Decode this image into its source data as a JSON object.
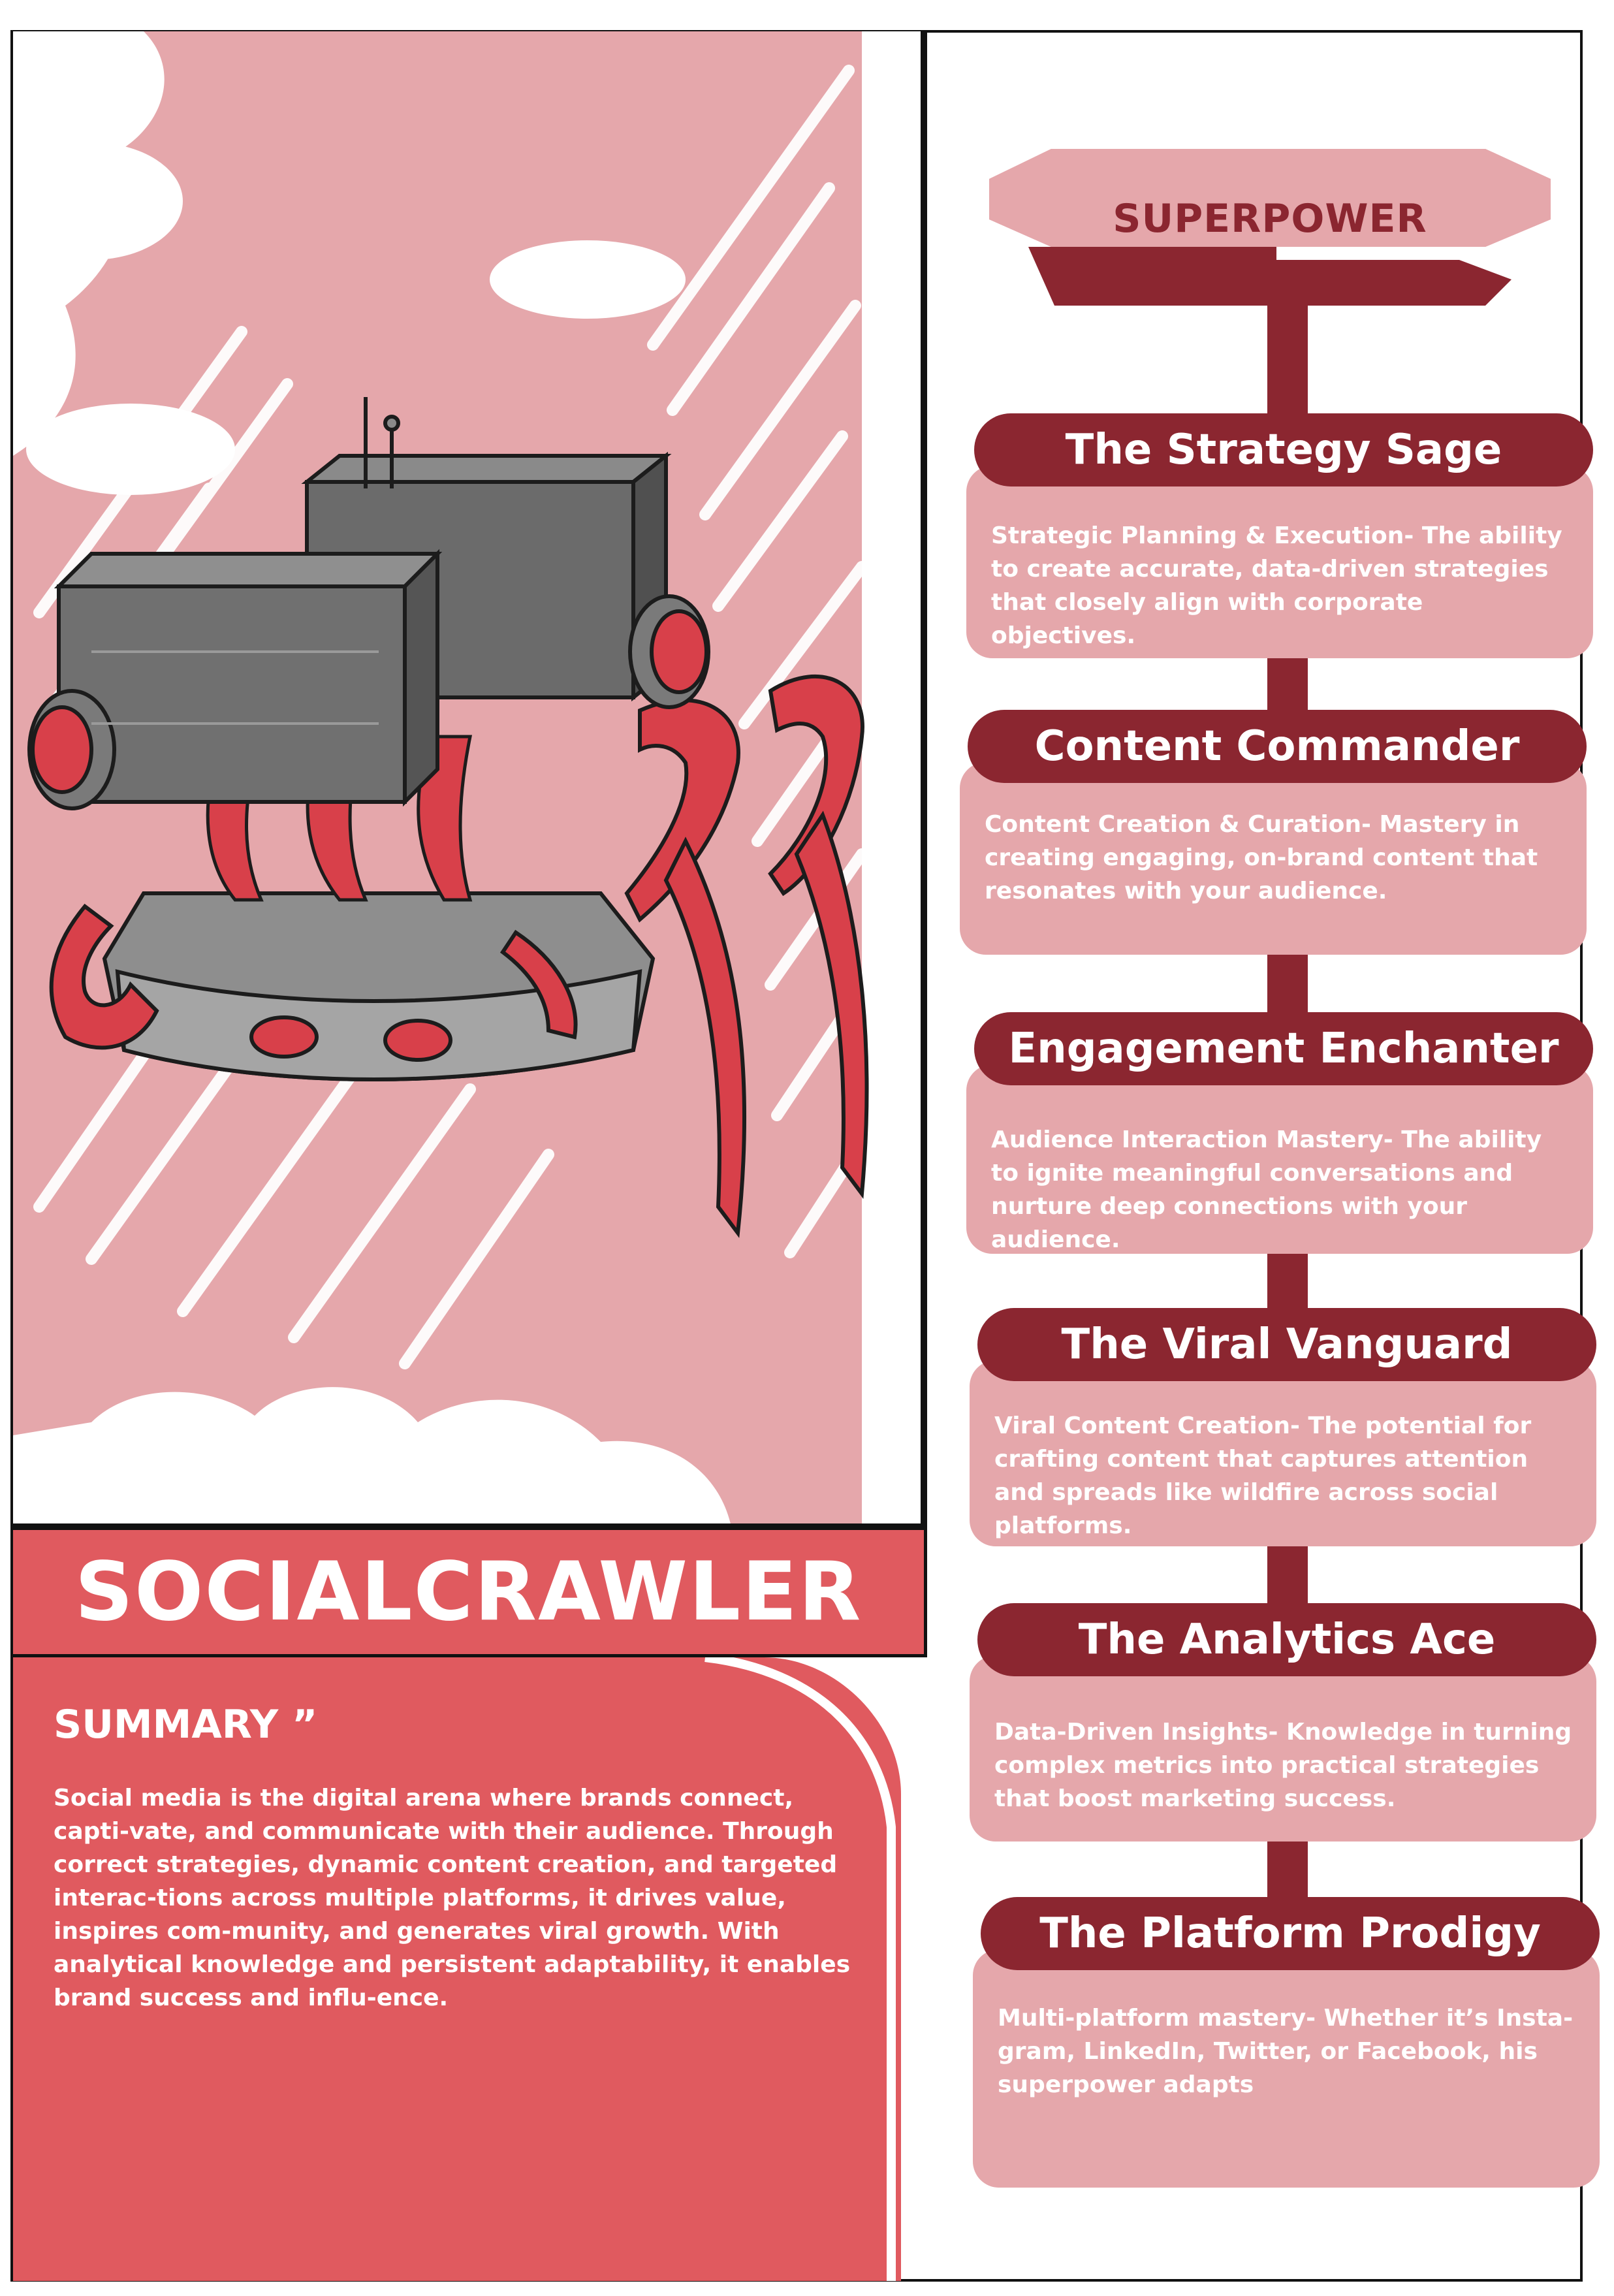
{
  "character": {
    "name": "SOCIALCRAWLER"
  },
  "summary": {
    "title": "SUMMARY ”",
    "text": "Social media is the digital arena where brands connect, capti-vate, and communicate with their audience. Through correct strategies, dynamic content creation, and targeted interac-tions across multiple platforms, it drives value, inspires com-munity, and generates viral growth. With analytical knowledge and persistent adaptability, it enables brand success and influ-ence."
  },
  "superpower": {
    "label": "SUPERPOWER",
    "cards": [
      {
        "title": "The Strategy Sage",
        "text": "Strategic Planning & Execution- The ability to create accurate, data-driven strategies that closely align with corporate objectives."
      },
      {
        "title": "Content Commander",
        "text": "Content Creation & Curation- Mastery in creating engaging, on-brand content that resonates with your audience."
      },
      {
        "title": "Engagement Enchanter",
        "text": "Audience Interaction Mastery- The ability to ignite meaningful conversations and nurture deep connections with your audience."
      },
      {
        "title": "The Viral Vanguard",
        "text": "Viral Content Creation- The potential for crafting content that captures attention and spreads like wildfire across social platforms."
      },
      {
        "title": "The Analytics Ace",
        "text": "Data-Driven Insights- Knowledge in turning complex metrics into practical strategies that boost marketing success."
      },
      {
        "title": "The Platform Prodigy",
        "text": "Multi-platform mastery- Whether it’s Insta-gram, LinkedIn, Twitter, or Facebook, his superpower adapts"
      }
    ]
  },
  "colors": {
    "dark_red": "#8b2630",
    "mid_red": "#e05a5f",
    "pink": "#e5a7ab",
    "crab_red": "#d8404a",
    "metal": "#6b6b6b"
  }
}
